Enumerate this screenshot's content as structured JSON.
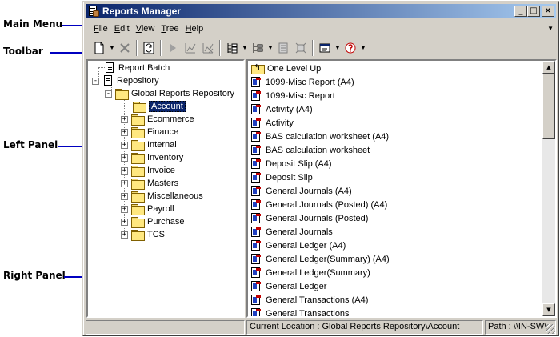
{
  "callouts": {
    "main_menu": "Main Menu",
    "toolbar": "Toolbar",
    "left_panel": "Left Panel",
    "right_panel": "Right Panel"
  },
  "window": {
    "title": "Reports Manager",
    "title_bg": "#0a246a",
    "minimize": "_",
    "maximize": "□",
    "close": "×"
  },
  "menu": [
    {
      "label": "File",
      "key": "F",
      "rest": "ile"
    },
    {
      "label": "Edit",
      "key": "E",
      "rest": "dit"
    },
    {
      "label": "View",
      "key": "V",
      "rest": "iew"
    },
    {
      "label": "Tree",
      "key": "T",
      "rest": "ree"
    },
    {
      "label": "Help",
      "key": "H",
      "rest": "elp"
    }
  ],
  "toolbar_icons": [
    "new-document-icon",
    "delete-icon",
    "refresh-icon",
    "run-icon",
    "chart-icon",
    "chart-delete-icon",
    "tree-view-icon",
    "list-view-icon",
    "import-icon",
    "export-icon",
    "edit-icon",
    "help-icon"
  ],
  "tree": {
    "report_batch": "Report Batch",
    "repository": "Repository",
    "global_repository": "Global Reports Repository",
    "selected": "Account",
    "folders": [
      "Ecommerce",
      "Finance",
      "Internal",
      "Inventory",
      "Invoice",
      "Masters",
      "Miscellaneous",
      "Payroll",
      "Purchase",
      "TCS"
    ]
  },
  "list": {
    "up": "One Level Up",
    "items": [
      "1099-Misc Report (A4)",
      "1099-Misc Report",
      "Activity (A4)",
      "Activity",
      "BAS calculation worksheet (A4)",
      "BAS calculation worksheet",
      "Deposit Slip (A4)",
      "Deposit Slip",
      "General Journals (A4)",
      "General Journals (Posted) (A4)",
      "General Journals (Posted)",
      "General Journals",
      "General Ledger (A4)",
      "General Ledger(Summary) (A4)",
      "General Ledger(Summary)",
      "General Ledger",
      "General Transactions (A4)",
      "General Transactions"
    ]
  },
  "status": {
    "left": "",
    "location": "Current Location : Global Reports Repository\\Account",
    "path": "Path : \\\\IN-SW\\"
  }
}
